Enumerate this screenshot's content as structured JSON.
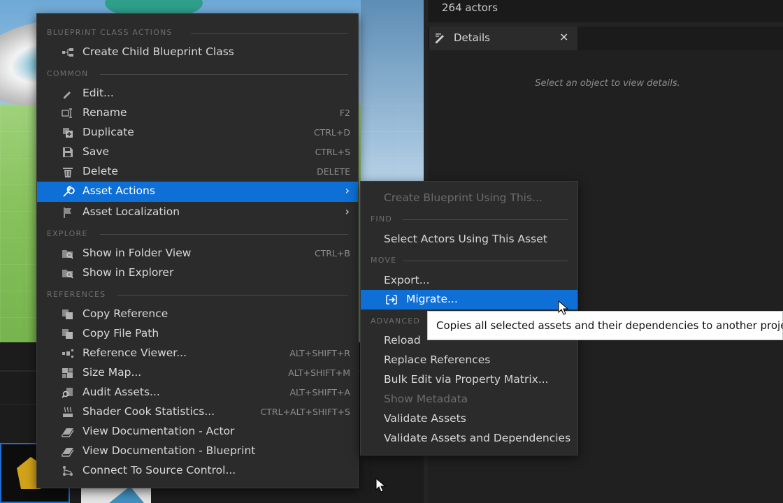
{
  "outliner": {
    "actors_count": "264 actors"
  },
  "details": {
    "tab_title": "Details",
    "close_glyph": "×",
    "empty_message": "Select an object to view details."
  },
  "context_menu": {
    "sections": {
      "blueprint_class_actions": "BLUEPRINT CLASS ACTIONS",
      "common": "COMMON",
      "explore": "EXPLORE",
      "references": "REFERENCES"
    },
    "items": {
      "create_child": {
        "label": "Create Child Blueprint Class",
        "icon": "blueprint-child-icon"
      },
      "edit": {
        "label": "Edit...",
        "icon": "pencil-icon"
      },
      "rename": {
        "label": "Rename",
        "shortcut": "F2",
        "icon": "rename-icon"
      },
      "duplicate": {
        "label": "Duplicate",
        "shortcut": "CTRL+D",
        "icon": "duplicate-icon"
      },
      "save": {
        "label": "Save",
        "shortcut": "CTRL+S",
        "icon": "save-icon"
      },
      "delete": {
        "label": "Delete",
        "shortcut": "DELETE",
        "icon": "trash-icon"
      },
      "asset_actions": {
        "label": "Asset Actions",
        "icon": "wrench-icon",
        "highlighted": true
      },
      "asset_localization": {
        "label": "Asset Localization",
        "icon": "flag-icon"
      },
      "show_folder_view": {
        "label": "Show in Folder View",
        "shortcut": "CTRL+B",
        "icon": "folder-search-icon"
      },
      "show_explorer": {
        "label": "Show in Explorer",
        "icon": "folder-search-icon"
      },
      "copy_reference": {
        "label": "Copy Reference",
        "icon": "copy-icon"
      },
      "copy_file_path": {
        "label": "Copy File Path",
        "icon": "copy-icon"
      },
      "reference_viewer": {
        "label": "Reference Viewer...",
        "shortcut": "ALT+SHIFT+R",
        "icon": "graph-icon"
      },
      "size_map": {
        "label": "Size Map...",
        "shortcut": "ALT+SHIFT+M",
        "icon": "size-map-icon"
      },
      "audit_assets": {
        "label": "Audit Assets...",
        "shortcut": "ALT+SHIFT+A",
        "icon": "audit-icon"
      },
      "shader_cook": {
        "label": "Shader Cook Statistics...",
        "shortcut": "CTRL+ALT+SHIFT+S",
        "icon": "shader-icon"
      },
      "view_doc_actor": {
        "label": "View Documentation - Actor",
        "icon": "book-icon"
      },
      "view_doc_blueprint": {
        "label": "View Documentation - Blueprint",
        "icon": "book-icon"
      },
      "source_control": {
        "label": "Connect To Source Control...",
        "icon": "source-control-icon"
      }
    }
  },
  "submenu": {
    "sections": {
      "find": "FIND",
      "move": "MOVE",
      "advanced": "ADVANCED"
    },
    "items": {
      "create_blueprint": {
        "label": "Create Blueprint Using This...",
        "enabled": false
      },
      "select_actors": {
        "label": "Select Actors Using This Asset"
      },
      "export": {
        "label": "Export..."
      },
      "migrate": {
        "label": "Migrate...",
        "icon": "migrate-icon",
        "highlighted": true
      },
      "reload": {
        "label": "Reload"
      },
      "replace_refs": {
        "label": "Replace References"
      },
      "bulk_edit": {
        "label": "Bulk Edit via Property Matrix..."
      },
      "show_metadata": {
        "label": "Show Metadata",
        "enabled": false
      },
      "validate_assets": {
        "label": "Validate Assets"
      },
      "validate_deps": {
        "label": "Validate Assets and Dependencies"
      }
    }
  },
  "tooltip": {
    "text": "Copies all selected assets and their dependencies to another project"
  },
  "colors": {
    "highlight": "#0E6FD6",
    "menu_bg": "#2B2B2B"
  }
}
